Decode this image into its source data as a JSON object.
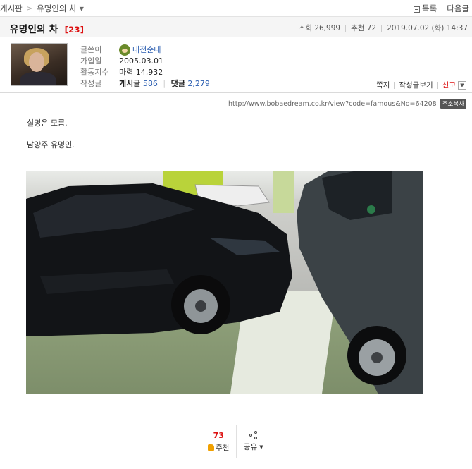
{
  "breadcrumb": {
    "board": "게시판",
    "current": "유명인의 차"
  },
  "top_actions": {
    "list": "목록",
    "next": "다음글"
  },
  "post": {
    "title": "유명인의 차",
    "comment_count": "[23]",
    "views": "조회 26,999",
    "recommend": "추천 72",
    "datetime": "2019.07.02 (화) 14:37"
  },
  "author": {
    "labels": {
      "writer": "글쓴이",
      "joined": "가입일",
      "activity": "활동지수",
      "posts": "작성글"
    },
    "nickname": "대전순대",
    "joined": "2005.03.01",
    "activity": "마력 14,932",
    "post_label": "게시글",
    "post_count": "586",
    "comment_label": "댓글",
    "comment_count": "2,279"
  },
  "author_actions": {
    "message": "쪽지",
    "view_posts": "작성글보기",
    "report": "신고"
  },
  "url": {
    "text": "http://www.bobaedream.co.kr/view?code=famous&No=64208",
    "copy_label": "주소복사"
  },
  "content": {
    "line1": "실명은 모름.",
    "line2": "남양주 유명인."
  },
  "reaction": {
    "count": "73",
    "recommend_label": "추천",
    "share_label": "공유"
  },
  "colors": {
    "accent_red": "#dd1111",
    "link_blue": "#2a5db0"
  }
}
